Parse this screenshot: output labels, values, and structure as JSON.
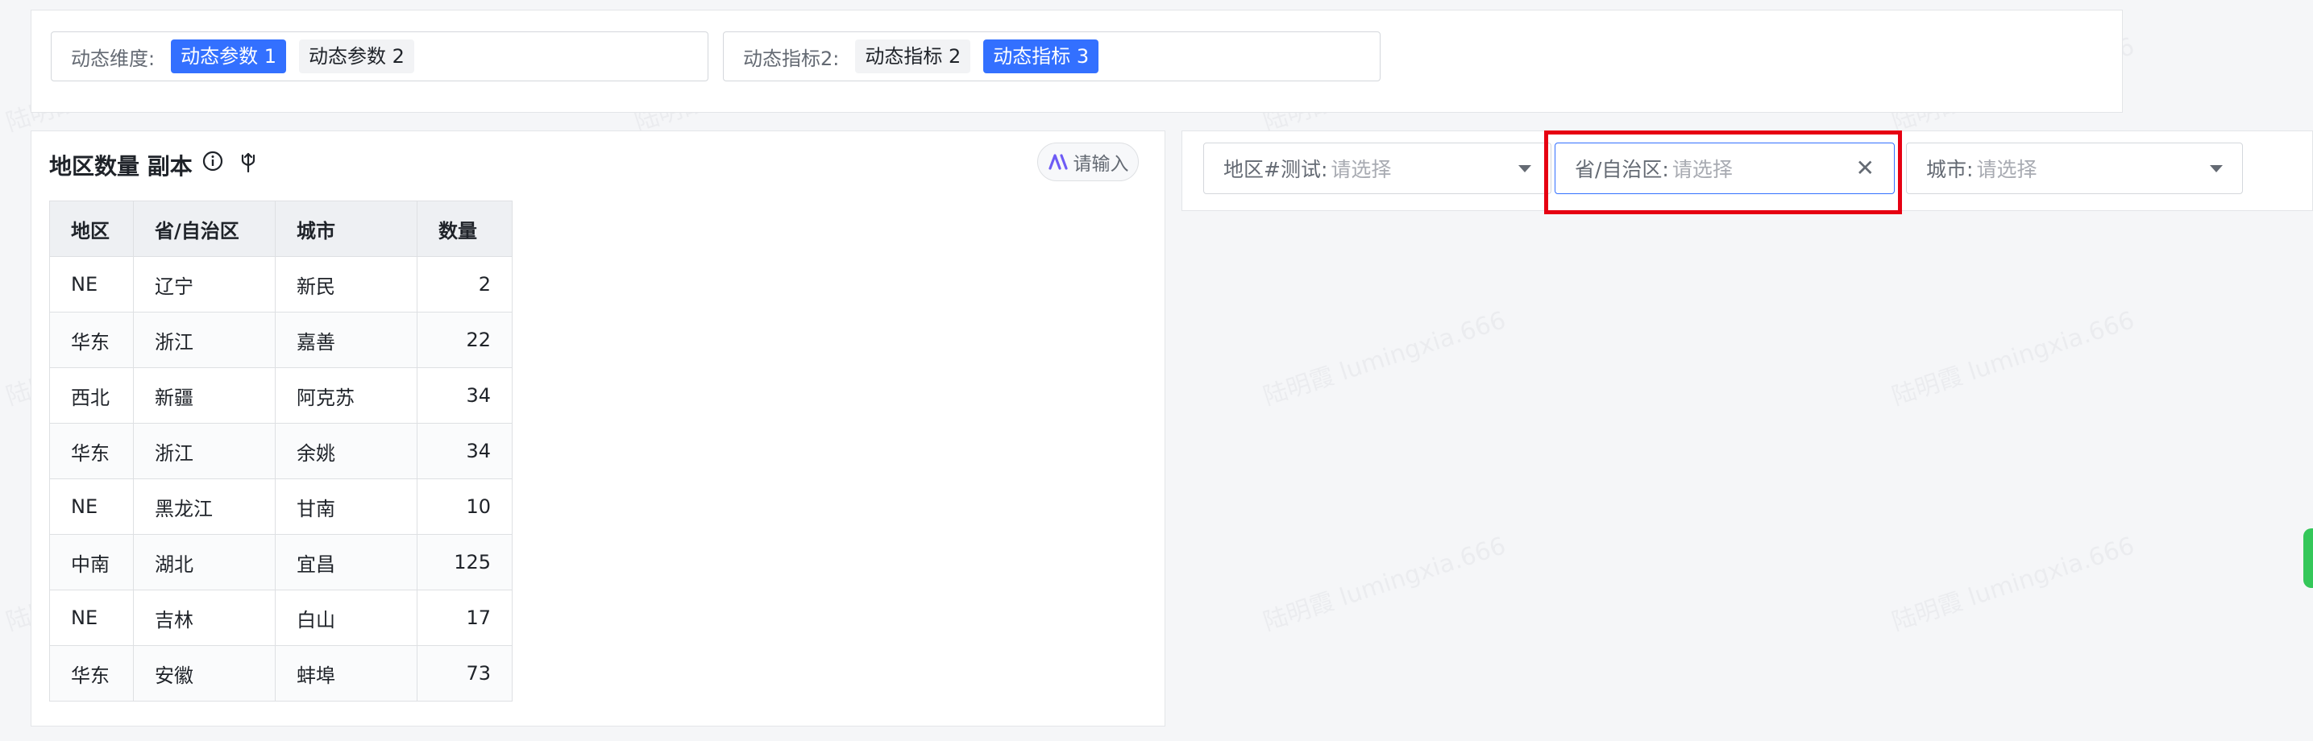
{
  "params": {
    "dim": {
      "label": "动态维度:",
      "chips": [
        {
          "text": "动态参数 1",
          "active": true
        },
        {
          "text": "动态参数 2",
          "active": false
        }
      ]
    },
    "metric": {
      "label": "动态指标2:",
      "chips": [
        {
          "text": "动态指标 2",
          "active": false
        },
        {
          "text": "动态指标 3",
          "active": true
        }
      ]
    }
  },
  "table_panel": {
    "title": "地区数量 副本",
    "ai_button": "请输入",
    "columns": [
      "地区",
      "省/自治区",
      "城市",
      "数量"
    ],
    "rows": [
      [
        "NE",
        "辽宁",
        "新民",
        "2"
      ],
      [
        "华东",
        "浙江",
        "嘉善",
        "22"
      ],
      [
        "西北",
        "新疆",
        "阿克苏",
        "34"
      ],
      [
        "华东",
        "浙江",
        "余姚",
        "34"
      ],
      [
        "NE",
        "黑龙江",
        "甘南",
        "10"
      ],
      [
        "中南",
        "湖北",
        "宜昌",
        "125"
      ],
      [
        "NE",
        "吉林",
        "白山",
        "17"
      ],
      [
        "华东",
        "安徽",
        "蚌埠",
        "73"
      ]
    ]
  },
  "filters": {
    "region": {
      "label": "地区#测试:",
      "placeholder": "请选择"
    },
    "province": {
      "label": "省/自治区:",
      "placeholder": "请选择"
    },
    "city": {
      "label": "城市:",
      "placeholder": "请选择"
    }
  },
  "watermark": "陆明霞 lumingxia.666",
  "colors": {
    "accent": "#3370ff",
    "highlight": "#e60012",
    "side_tab": "#34c759"
  }
}
